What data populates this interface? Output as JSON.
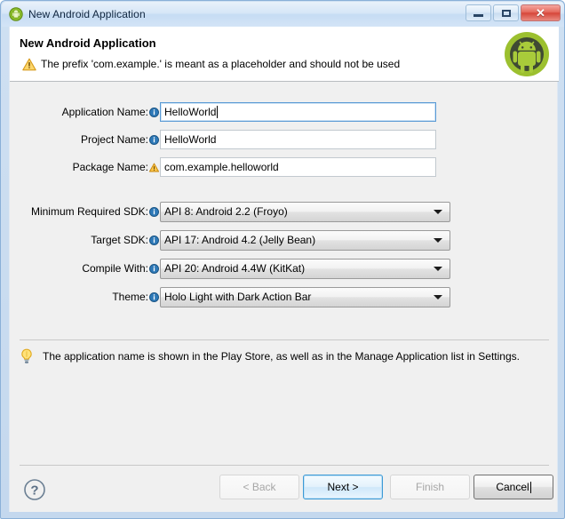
{
  "window": {
    "title": "New Android Application",
    "app_icon": "android-head-icon",
    "controls": {
      "minimize": "minimize-icon",
      "maximize": "maximize-icon",
      "close": "close-icon"
    }
  },
  "header": {
    "title": "New Android Application",
    "message": "The prefix 'com.example.' is meant as a placeholder and should not be used",
    "message_icon": "warning-triangle-icon",
    "brand_icon": "android-robot-icon"
  },
  "form": {
    "fields": [
      {
        "label": "Application Name:",
        "decorator": "info-icon",
        "value": "HelloWorld",
        "type": "text",
        "focused": true
      },
      {
        "label": "Project Name:",
        "decorator": "info-icon",
        "value": "HelloWorld",
        "type": "text",
        "focused": false
      },
      {
        "label": "Package Name:",
        "decorator": "warning-icon",
        "value": "com.example.helloworld",
        "type": "text",
        "focused": false
      }
    ],
    "selects": [
      {
        "label": "Minimum Required SDK:",
        "decorator": "info-icon",
        "value": "API 8: Android 2.2 (Froyo)"
      },
      {
        "label": "Target SDK:",
        "decorator": "info-icon",
        "value": "API 17: Android 4.2 (Jelly Bean)"
      },
      {
        "label": "Compile With:",
        "decorator": "info-icon",
        "value": "API 20: Android 4.4W (KitKat)"
      },
      {
        "label": "Theme:",
        "decorator": "info-icon",
        "value": "Holo Light with Dark Action Bar"
      }
    ]
  },
  "hint": {
    "icon": "lightbulb-icon",
    "text": "The application name is shown in the Play Store, as well as in the Manage Application list in Settings."
  },
  "buttons": {
    "help": "help-question-icon",
    "back": "< Back",
    "next": "Next >",
    "finish": "Finish",
    "cancel": "Cancel"
  },
  "colors": {
    "title_bar": "#d6e6f7",
    "window_border": "#8ab0d8",
    "body_background": "#f0f0f0",
    "header_background": "#ffffff",
    "focus_blue": "#3c9ad6",
    "android_green": "#a4c639",
    "warning_orange": "#f0a30a",
    "info_blue": "#2e6da4"
  }
}
